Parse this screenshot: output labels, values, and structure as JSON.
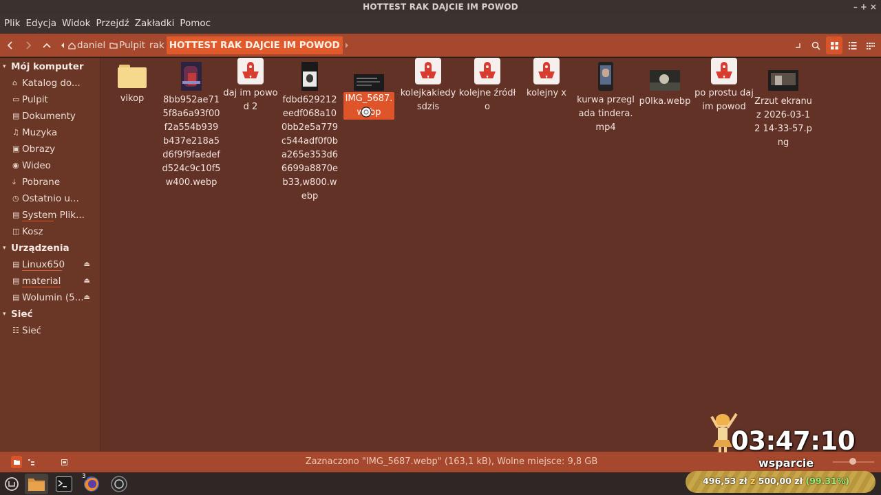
{
  "window": {
    "title": "HOTTEST RAK DAJCIE IM POWOD",
    "controls": [
      "–",
      "+",
      "×"
    ]
  },
  "menubar": {
    "items": [
      "Plik",
      "Edycja",
      "Widok",
      "Przejdź",
      "Zakładki",
      "Pomoc"
    ]
  },
  "toolbar": {
    "breadcrumbs": [
      {
        "label": "daniel",
        "icon": "home-icon"
      },
      {
        "label": "Pulpit",
        "icon": "folder-icon"
      },
      {
        "label": "rak",
        "icon": ""
      },
      {
        "label": "HOTTEST RAK DAJCIE IM POWOD",
        "icon": ""
      }
    ],
    "view_mode": "icons"
  },
  "sidebar": {
    "sections": [
      {
        "title": "Mój komputer",
        "items": [
          {
            "label": "Katalog do...",
            "icon": "home-icon"
          },
          {
            "label": "Pulpit",
            "icon": "desktop-icon"
          },
          {
            "label": "Dokumenty",
            "icon": "documents-icon"
          },
          {
            "label": "Muzyka",
            "icon": "music-icon"
          },
          {
            "label": "Obrazy",
            "icon": "pictures-icon"
          },
          {
            "label": "Wideo",
            "icon": "video-icon"
          },
          {
            "label": "Pobrane",
            "icon": "download-icon"
          },
          {
            "label": "Ostatnio u...",
            "icon": "recent-icon"
          },
          {
            "label": "System Plik...",
            "icon": "drive-icon"
          },
          {
            "label": "Kosz",
            "icon": "trash-icon"
          }
        ]
      },
      {
        "title": "Urządzenia",
        "items": [
          {
            "label": "Linux650",
            "icon": "drive-icon",
            "eject": true
          },
          {
            "label": "material",
            "icon": "drive-icon",
            "eject": true
          },
          {
            "label": "Wolumin (5...",
            "icon": "drive-icon",
            "eject": true
          }
        ]
      },
      {
        "title": "Sieć",
        "items": [
          {
            "label": "Sieć",
            "icon": "network-icon"
          }
        ]
      }
    ]
  },
  "files": [
    {
      "name": "vikop",
      "type": "folder"
    },
    {
      "name": "8bb952ae715f8a6a93f00f2a554b939b437e218a5d6f9f9faedefd524c9c10f5w400.webp",
      "type": "image"
    },
    {
      "name": "daj im powod 2",
      "type": "rocket"
    },
    {
      "name": "fdbd629212eedf068a100bb2e5a779c544adf0f0ba265e353d66699a8870eb33,w800.webp",
      "type": "image"
    },
    {
      "name": "IMG_5687.webp",
      "type": "image",
      "selected": true
    },
    {
      "name": "kolejkakiedysdzis",
      "type": "rocket"
    },
    {
      "name": "kolejne źródło",
      "type": "rocket"
    },
    {
      "name": "kolejny x",
      "type": "rocket"
    },
    {
      "name": "kurwa przeglada tindera.mp4",
      "type": "video"
    },
    {
      "name": "p0lka.webp",
      "type": "image"
    },
    {
      "name": "po prostu daj im powod",
      "type": "rocket"
    },
    {
      "name": "Zrzut ekranu z 2026-03-12 14-33-57.png",
      "type": "image"
    }
  ],
  "statusbar": {
    "text": "Zaznaczono \"IMG_5687.webp\" (163,1 kB), Wolne miejsce: 9,8 GB",
    "zoom_level": 0.6
  },
  "taskbar": {
    "items": [
      "menu-icon",
      "files-icon",
      "terminal-icon",
      "firefox-icon",
      "obs-icon"
    ],
    "firefox_badge": "3"
  },
  "overlay": {
    "timer": "03:47:10",
    "support_label": "wsparcie",
    "donation_current": "496,53 zł",
    "donation_sep": "z",
    "donation_goal": "500,00 zł",
    "donation_pct": "(99.31%)"
  },
  "colors": {
    "accent": "#e0542a",
    "toolbar": "#a5482d",
    "background": "#633226",
    "sidebar": "#6a3727"
  }
}
